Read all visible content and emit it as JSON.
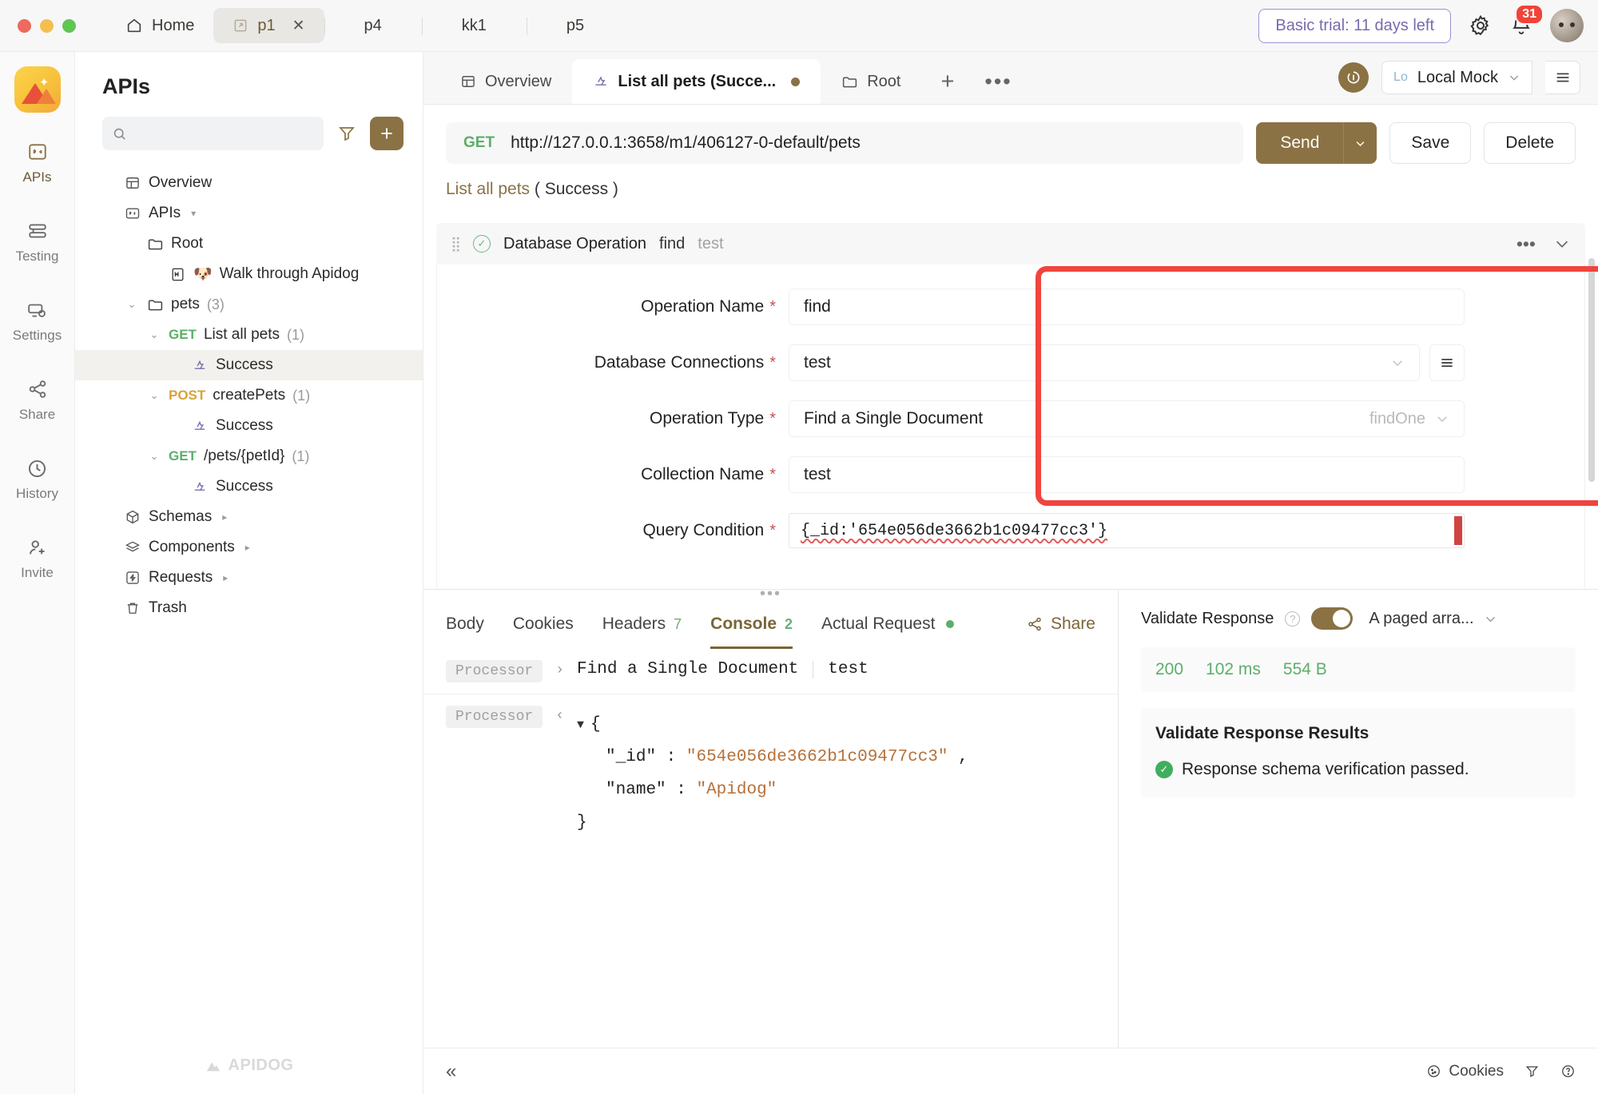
{
  "window": {
    "home_label": "Home",
    "tabs": [
      {
        "label": "p1",
        "active": true,
        "closable": true
      },
      {
        "label": "p4",
        "active": false
      },
      {
        "label": "kk1",
        "active": false
      },
      {
        "label": "p5",
        "active": false
      }
    ],
    "trial_badge": "Basic trial: 11 days left",
    "notification_count": "31",
    "accent_brown": "#8a7244",
    "trial_purple": "#7a6aae",
    "highlight_red": "#f0453e"
  },
  "rail": {
    "items": [
      {
        "label": "APIs",
        "icon": "api-icon",
        "active": true
      },
      {
        "label": "Testing",
        "icon": "testing-icon",
        "active": false
      },
      {
        "label": "Settings",
        "icon": "settings-icon",
        "active": false
      },
      {
        "label": "Share",
        "icon": "share-icon",
        "active": false
      },
      {
        "label": "History",
        "icon": "history-icon",
        "active": false
      },
      {
        "label": "Invite",
        "icon": "invite-icon",
        "active": false
      }
    ]
  },
  "sidebar": {
    "title": "APIs",
    "search_placeholder": "",
    "search_value": "",
    "watermark": "APIDOG",
    "tree": [
      {
        "label": "Overview",
        "icon": "overview-icon",
        "indent": 0,
        "chevron": "",
        "method": "",
        "count": "",
        "selected": false
      },
      {
        "label": "APIs",
        "icon": "api-icon",
        "indent": 0,
        "chevron": "",
        "method": "",
        "count": "",
        "caret": "▾",
        "selected": false
      },
      {
        "label": "Root",
        "icon": "folder-icon",
        "indent": 1,
        "chevron": "",
        "method": "",
        "count": "",
        "selected": false
      },
      {
        "label": "Walk through Apidog",
        "icon": "markdown-icon",
        "indent": 2,
        "chevron": "",
        "method": "",
        "count": "",
        "emoji": "🐶",
        "selected": false
      },
      {
        "label": "pets",
        "icon": "folder-icon",
        "indent": 1,
        "chevron": "⌄",
        "method": "",
        "count": "(3)",
        "selected": false
      },
      {
        "label": "List all pets",
        "icon": "",
        "indent": 2,
        "chevron": "⌄",
        "method": "GET",
        "count": "(1)",
        "selected": false
      },
      {
        "label": "Success",
        "icon": "response-icon",
        "indent": 3,
        "chevron": "",
        "method": "",
        "count": "",
        "selected": true
      },
      {
        "label": "createPets",
        "icon": "",
        "indent": 2,
        "chevron": "⌄",
        "method": "POST",
        "count": "(1)",
        "selected": false
      },
      {
        "label": "Success",
        "icon": "response-icon",
        "indent": 3,
        "chevron": "",
        "method": "",
        "count": "",
        "selected": false
      },
      {
        "label": "/pets/{petId}",
        "icon": "",
        "indent": 2,
        "chevron": "⌄",
        "method": "GET",
        "count": "(1)",
        "selected": false
      },
      {
        "label": "Success",
        "icon": "response-icon",
        "indent": 3,
        "chevron": "",
        "method": "",
        "count": "",
        "selected": false
      },
      {
        "label": "Schemas",
        "icon": "schema-icon",
        "indent": 0,
        "chevron": "",
        "method": "",
        "count": "",
        "caret": "▸",
        "selected": false
      },
      {
        "label": "Components",
        "icon": "components-icon",
        "indent": 0,
        "chevron": "",
        "method": "",
        "count": "",
        "caret": "▸",
        "selected": false
      },
      {
        "label": "Requests",
        "icon": "requests-icon",
        "indent": 0,
        "chevron": "",
        "method": "",
        "count": "",
        "caret": "▸",
        "selected": false
      },
      {
        "label": "Trash",
        "icon": "trash-icon",
        "indent": 0,
        "chevron": "",
        "method": "",
        "count": "",
        "selected": false
      }
    ]
  },
  "content_tabs": {
    "tabs": [
      {
        "label": "Overview",
        "icon": "overview-icon",
        "active": false,
        "dirty": false
      },
      {
        "label": "List all pets (Succe...",
        "icon": "response-icon",
        "active": true,
        "dirty": true
      },
      {
        "label": "Root",
        "icon": "folder-icon",
        "active": false,
        "dirty": false
      }
    ],
    "add_label": "+",
    "more_label": "•••",
    "env_tag": "Lo",
    "env_name": "Local Mock"
  },
  "request": {
    "method": "GET",
    "url": "http://127.0.0.1:3658/m1/406127-0-default/pets",
    "send_label": "Send",
    "save_label": "Save",
    "delete_label": "Delete",
    "breadcrumb_name": "List all pets",
    "breadcrumb_status": "( Success )"
  },
  "operation": {
    "header_title": "Database Operation",
    "header_name": "find",
    "header_db": "test",
    "fields": [
      {
        "label": "Operation Name",
        "required": "*",
        "value": "find",
        "type": "text"
      },
      {
        "label": "Database Connections",
        "required": "*",
        "value": "test",
        "type": "select-ham"
      },
      {
        "label": "Operation Type",
        "required": "*",
        "value": "Find a Single Document",
        "hint": "findOne",
        "type": "select-hint"
      },
      {
        "label": "Collection Name",
        "required": "*",
        "value": "test",
        "type": "text"
      },
      {
        "label": "Query Condition",
        "required": "*",
        "value": "{_id:'654e056de3662b1c09477cc3'}",
        "type": "code"
      }
    ]
  },
  "bottom_tabs": {
    "tabs": [
      {
        "label": "Body",
        "count": "",
        "active": false,
        "dot": false
      },
      {
        "label": "Cookies",
        "count": "",
        "active": false,
        "dot": false
      },
      {
        "label": "Headers",
        "count": "7",
        "active": false,
        "dot": false
      },
      {
        "label": "Console",
        "count": "2",
        "active": true,
        "dot": false
      },
      {
        "label": "Actual Request",
        "count": "",
        "active": false,
        "dot": true
      }
    ],
    "share_label": "Share"
  },
  "console": {
    "row1": {
      "tag": "Processor",
      "arrow": "›",
      "text": "Find a Single Document",
      "db": "test"
    },
    "row2": {
      "tag": "Processor",
      "arrow": "‹",
      "open_brace": "{",
      "lines": [
        {
          "key": "\"_id\"",
          "sep": " : ",
          "value": "\"654e056de3662b1c09477cc3\"",
          "comma": " ,"
        },
        {
          "key": "\"name\"",
          "sep": " : ",
          "value": "\"Apidog\"",
          "comma": ""
        }
      ],
      "close_brace": "}"
    }
  },
  "validate": {
    "title": "Validate Response",
    "toggle_on": true,
    "schema_select": "A paged arra...",
    "status": "200",
    "time": "102 ms",
    "size": "554 B",
    "results_title": "Validate Response Results",
    "result_text": "Response schema verification passed."
  },
  "statusbar": {
    "collapse": "«",
    "cookies_label": "Cookies",
    "items": [
      "cookies-icon",
      "filter-icon",
      "help-icon"
    ]
  }
}
